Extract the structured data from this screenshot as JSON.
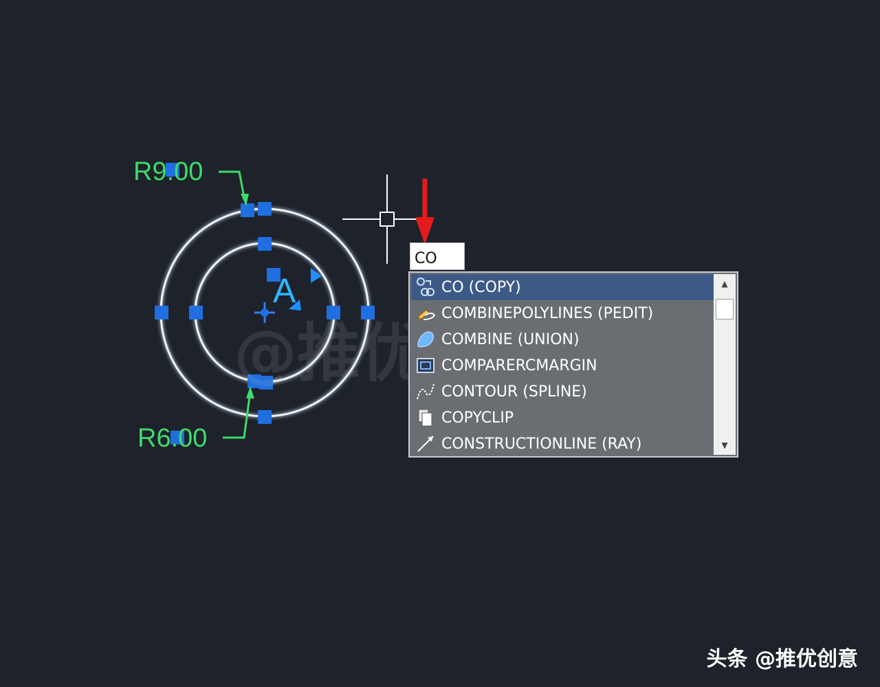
{
  "drawing": {
    "radius_outer_label": "R9.00",
    "radius_inner_label": "R6.00",
    "center_label": "A",
    "watermark": "@推优创意"
  },
  "command_line": {
    "input_value": "CO"
  },
  "autocomplete": {
    "items": [
      {
        "label": "CO (COPY)",
        "icon": "copy-icon",
        "selected": true
      },
      {
        "label": "COMBINEPOLYLINES (PEDIT)",
        "icon": "pencil-icon",
        "selected": false
      },
      {
        "label": "COMBINE (UNION)",
        "icon": "union-icon",
        "selected": false
      },
      {
        "label": "COMPARERCMARGIN",
        "icon": "compare-icon",
        "selected": false
      },
      {
        "label": "CONTOUR (SPLINE)",
        "icon": "spline-icon",
        "selected": false
      },
      {
        "label": "COPYCLIP",
        "icon": "clipboard-icon",
        "selected": false
      },
      {
        "label": "CONSTRUCTIONLINE (RAY)",
        "icon": "ray-icon",
        "selected": false
      }
    ]
  },
  "footer": {
    "credit": "头条 @推优创意"
  },
  "colors": {
    "background": "#1e222b",
    "circle": "#e8f4ff",
    "grip": "#1f6fe0",
    "dimension": "#3ddc6a",
    "annotation_arrow": "#e51b1b",
    "selected_row": "#3d5a86"
  }
}
